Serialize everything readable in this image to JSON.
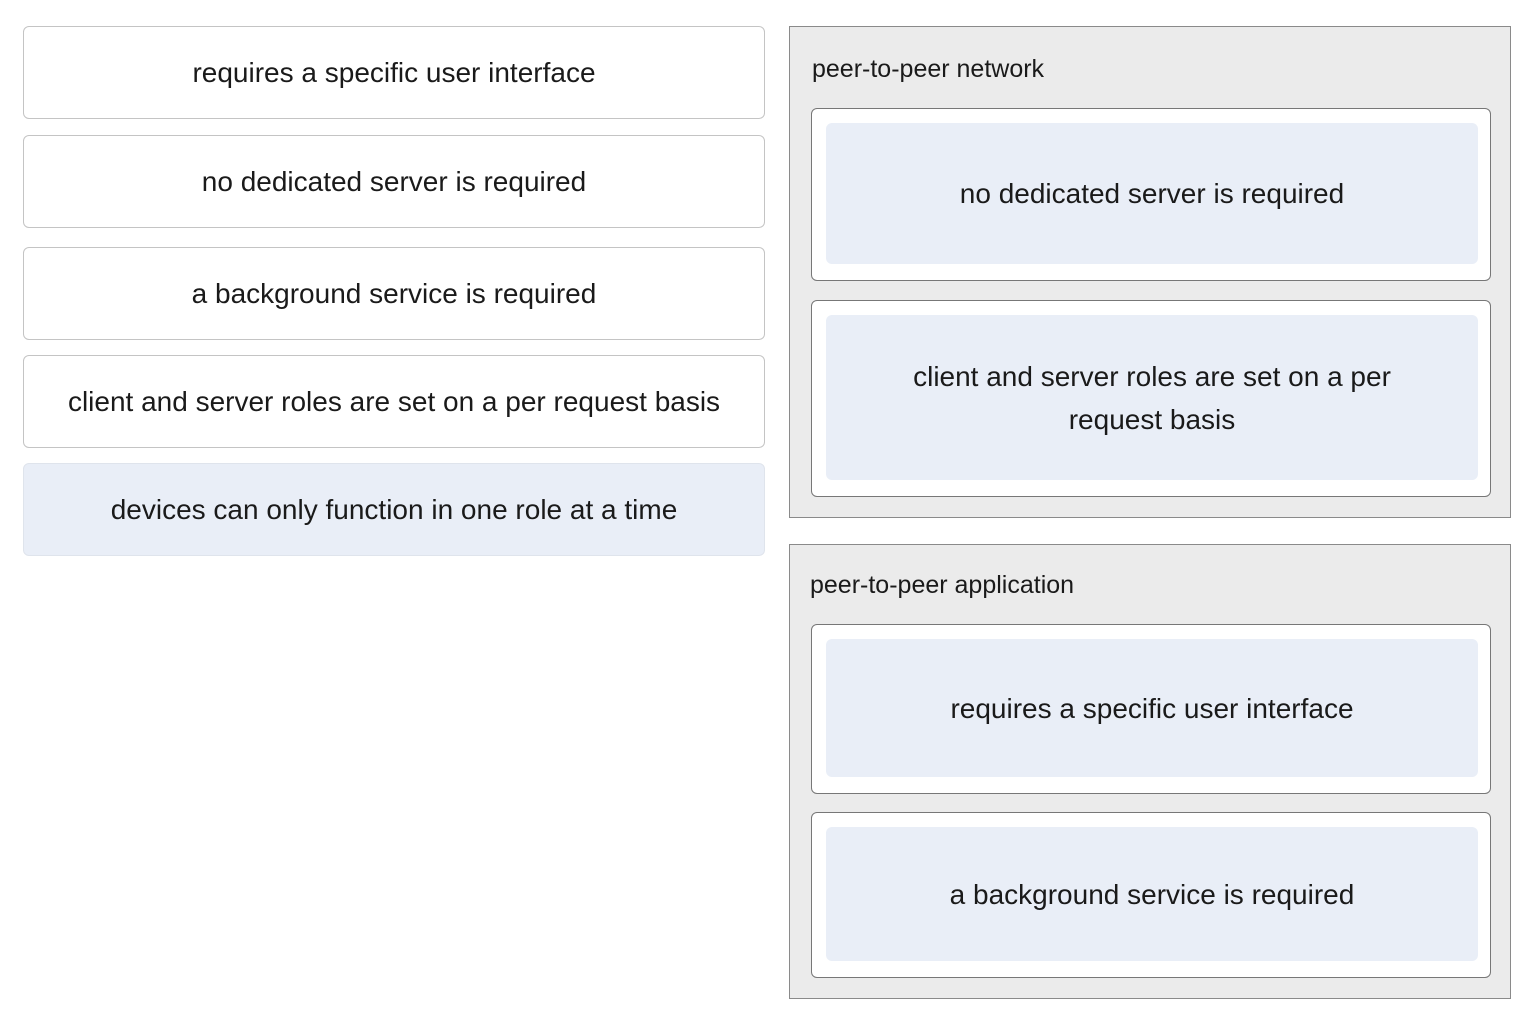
{
  "options": [
    {
      "label": "requires a specific user interface",
      "placed": false
    },
    {
      "label": "no dedicated server is required",
      "placed": false
    },
    {
      "label": "a background service is required",
      "placed": false
    },
    {
      "label": "client and server roles are set on a per request basis",
      "placed": false
    },
    {
      "label": "devices can only function in one role at a time",
      "placed": true
    }
  ],
  "categories": [
    {
      "title": "peer-to-peer network",
      "items": [
        "no dedicated server is required",
        "client and server roles are set on a per request basis"
      ]
    },
    {
      "title": "peer-to-peer application",
      "items": [
        "requires a specific user interface",
        "a background service is required"
      ]
    }
  ],
  "colors": {
    "item_fill": "#e9eef7",
    "category_bg": "#ebebeb",
    "border": "#c4c4c4"
  }
}
